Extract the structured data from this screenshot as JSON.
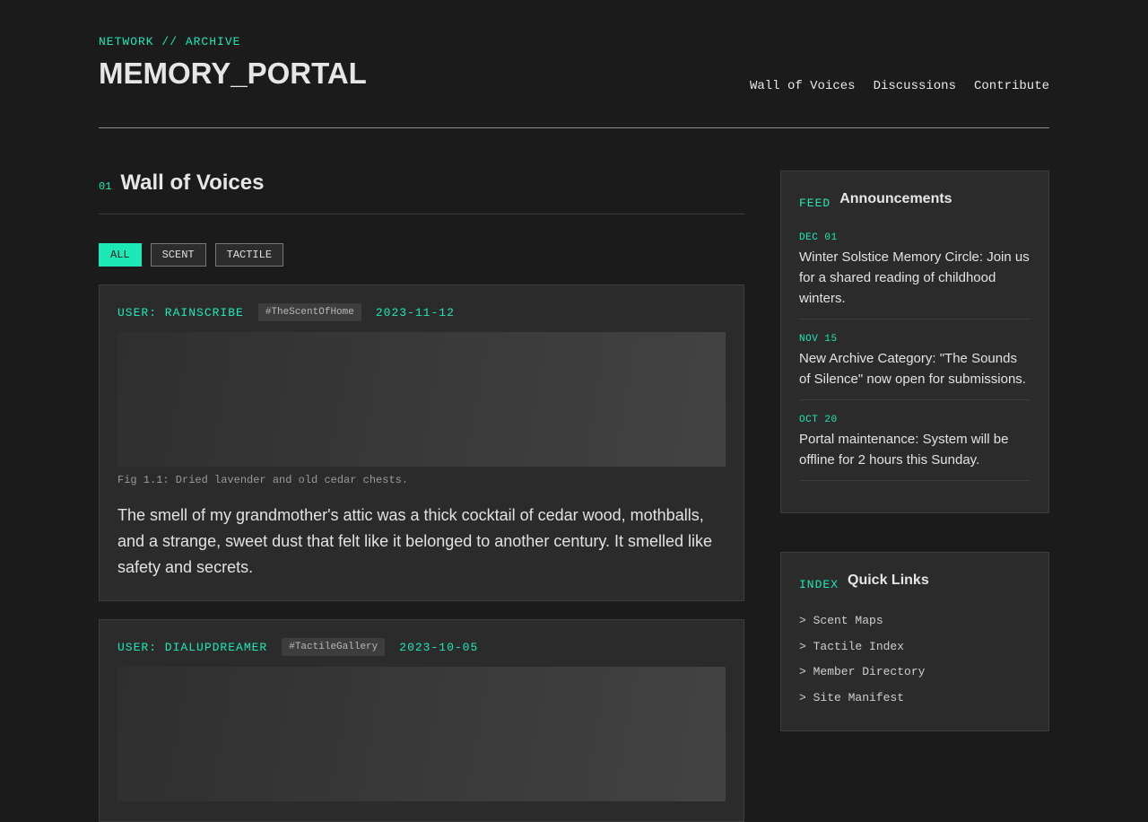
{
  "header": {
    "breadcrumb": "NETWORK // ARCHIVE",
    "title": "MEMORY_PORTAL",
    "nav": [
      "Wall of Voices",
      "Discussions",
      "Contribute"
    ]
  },
  "main": {
    "section_number": "01",
    "section_title": "Wall of Voices",
    "filters": [
      {
        "label": "ALL",
        "active": true
      },
      {
        "label": "SCENT",
        "active": false
      },
      {
        "label": "TACTILE",
        "active": false
      }
    ],
    "posts": [
      {
        "user": "USER: RAINSCRIBE",
        "tag": "#TheScentOfHome",
        "date": "2023-11-12",
        "caption": "Fig 1.1: Dried lavender and old cedar chests.",
        "body": "The smell of my grandmother's attic was a thick cocktail of cedar wood, mothballs, and a strange, sweet dust that felt like it belonged to another century. It smelled like safety and secrets."
      },
      {
        "user": "USER: DIALUPDREAMER",
        "tag": "#TactileGallery",
        "date": "2023-10-05"
      }
    ]
  },
  "sidebar": {
    "announcements": {
      "kicker": "FEED",
      "title": "Announcements",
      "items": [
        {
          "date": "DEC 01",
          "text": "Winter Solstice Memory Circle: Join us for a shared reading of childhood winters."
        },
        {
          "date": "NOV 15",
          "text": "New Archive Category: \"The Sounds of Silence\" now open for submissions."
        },
        {
          "date": "OCT 20",
          "text": "Portal maintenance: System will be offline for 2 hours this Sunday."
        }
      ]
    },
    "quick_links": {
      "kicker": "INDEX",
      "title": "Quick Links",
      "items": [
        "> Scent Maps",
        "> Tactile Index",
        "> Member Directory",
        "> Site Manifest"
      ]
    }
  },
  "colors": {
    "accent": "#1de9b6",
    "background": "#1b1b1b",
    "card": "#2b2b2b"
  }
}
